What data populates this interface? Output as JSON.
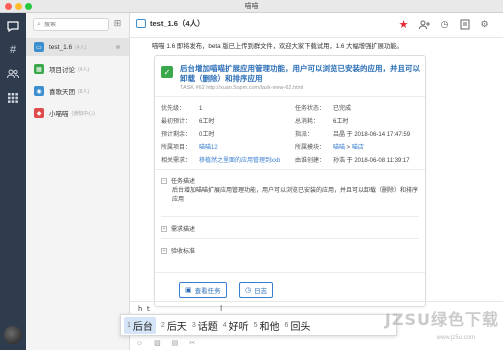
{
  "window": {
    "title": "喵喵"
  },
  "rail": {
    "items": [
      "chat-icon",
      "hash-icon",
      "people-icon",
      "apps-icon"
    ]
  },
  "search": {
    "placeholder": "搜索"
  },
  "conversations": [
    {
      "name": "test_1.6",
      "sub": "(4人)",
      "color": "#3c8fcf",
      "glyph": "▭",
      "active": true
    },
    {
      "name": "项目讨论",
      "sub": "(4人)",
      "color": "#3aa84a",
      "glyph": "▦",
      "active": false
    },
    {
      "name": "喜歌天团",
      "sub": "(8人)",
      "color": "#3c8fcf",
      "glyph": "◉",
      "active": false
    },
    {
      "name": "小喵喵",
      "sub": "(通知中心)",
      "color": "#e14b4b",
      "glyph": "◆",
      "active": false
    }
  ],
  "header": {
    "title": "test_1.6（4人）"
  },
  "message_top": "喵喵 1.6 即将发布，beta 版已上传到群文件，欢迎大家下载试用，1.6 大幅增强扩展功能。",
  "task": {
    "title": "后台增加喵喵扩展应用管理功能，用户可以浏览已安装的应用，并且可以卸载（删除）和排序应用",
    "code": "TASK #62 http://xuan.5upm.com/task-view-62.html",
    "fields": {
      "priority_label": "优先级：",
      "priority": "1",
      "status_label": "任务状态：",
      "status": "已完成",
      "est_label": "最初预计：",
      "est": "6工时",
      "used_label": "总消耗：",
      "used": "6工时",
      "left_label": "预计剩余：",
      "left": "0工时",
      "by_label": "指派：",
      "by": "吕晶 于 2018-06-14 17:47:59",
      "project_label": "所属项目：",
      "project": "喵喵12",
      "module_label": "所属模块：",
      "module_a": "喵喵",
      "module_sep": " > ",
      "module_b": "喵店",
      "demand_label": "相关需求：",
      "demand": "移植然之里面的应用管理到xxb",
      "done_label": "由谁创建：",
      "done": "孙浩 于 2018-06-08 11:39:17"
    },
    "sections": {
      "desc_title": "任务描述",
      "desc_body": "后台增加喵喵扩展应用管理功能，用户可以浏览已安装的应用，并且可以卸载（删除）和排序应用",
      "req_title": "需求描述",
      "accept_title": "验收标准"
    },
    "buttons": {
      "view": "查看任务",
      "log": "日志"
    }
  },
  "input": {
    "typed": "h t"
  },
  "ime": {
    "candidates": [
      {
        "n": "1",
        "text": "后台"
      },
      {
        "n": "2",
        "text": "后天"
      },
      {
        "n": "3",
        "text": "话题"
      },
      {
        "n": "4",
        "text": "好听"
      },
      {
        "n": "5",
        "text": "和他"
      },
      {
        "n": "6",
        "text": "回头"
      }
    ]
  },
  "watermark": {
    "main": "JZSU绿色下载",
    "sub": "www.jz5u.com"
  }
}
